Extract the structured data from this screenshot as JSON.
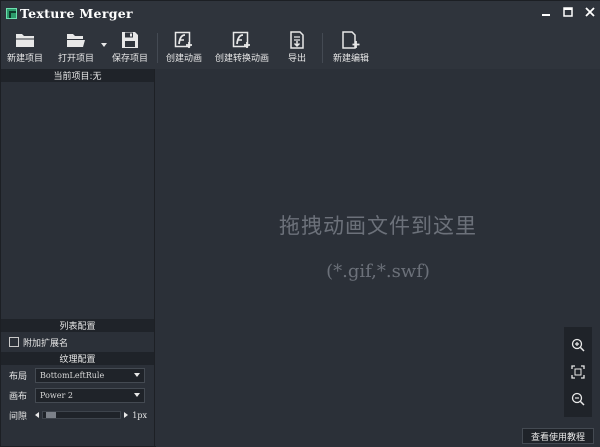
{
  "window": {
    "title": "Texture Merger"
  },
  "toolbar": {
    "new_project": "新建项目",
    "open_project": "打开项目",
    "save_project": "保存项目",
    "create_animation": "创建动画",
    "create_transform_animation": "创建转换动画",
    "export": "导出",
    "new_edit": "新建编辑"
  },
  "left_panel": {
    "current_project": "当前项目:无",
    "list_config_header": "列表配置",
    "append_extension_label": "附加扩展名",
    "append_extension_checked": false,
    "texture_config_header": "纹理配置",
    "layout_label": "布局",
    "layout_value": "BottomLeftRule",
    "canvas_label": "画布",
    "canvas_value": "Power 2",
    "padding_label": "间隙",
    "padding_value": "1px",
    "padding_fraction": 0.04
  },
  "main": {
    "drop_title": "拖拽动画文件到这里",
    "drop_hint": "(*.gif,*.swf)"
  },
  "status": {
    "tutorial_button": "查看使用教程"
  },
  "icons": {
    "app_logo": "texture-merger-logo",
    "minimize": "minimize-icon",
    "maximize": "maximize-icon",
    "close": "close-icon",
    "zoom_in": "zoom-in-icon",
    "fit": "fit-screen-icon",
    "zoom_out": "zoom-out-icon"
  },
  "colors": {
    "background": "#2b3038",
    "header": "#1f2329",
    "placeholder_text": "#6c717a",
    "logo_green": "#2c9b6b"
  }
}
